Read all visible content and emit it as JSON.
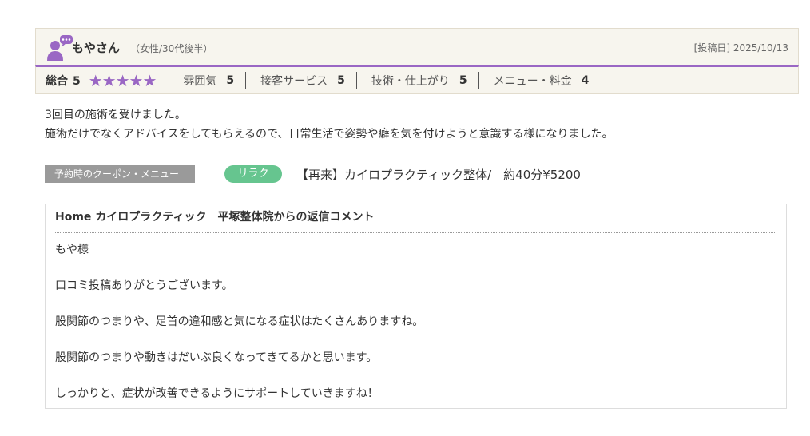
{
  "review": {
    "user_name": "もやさん",
    "user_meta": "（女性/30代後半）",
    "post_date": "[投稿日] 2025/10/13",
    "overall_label": "総合",
    "overall_value": "5",
    "stars_display": "★★★★★",
    "star_count": 5,
    "star_color": "#9a67c4",
    "categories": [
      {
        "label": "雰囲気",
        "value": "5"
      },
      {
        "label": "接客サービス",
        "value": "5"
      },
      {
        "label": "技術・仕上がり",
        "value": "5"
      },
      {
        "label": "メニュー・料金",
        "value": "4"
      }
    ],
    "comment_lines": [
      "3回目の施術を受けました。",
      "施術だけでなくアドバイスをしてもらえるので、日常生活で姿勢や癖を気を付けようと意識する様になりました。"
    ],
    "coupon": {
      "label": "予約時のクーポン・メニュー",
      "badge": "リラク",
      "badge_color": "#66c58f",
      "text": "【再来】カイロプラクティック整体/　約40分¥5200"
    },
    "reply": {
      "title": "Home カイロプラクティック　平塚整体院からの返信コメント",
      "paragraphs": [
        "もや様",
        "口コミ投稿ありがとうございます。",
        "股関節のつまりや、足首の違和感と気になる症状はたくさんありますね。",
        "股関節のつまりや動きはだいぶ良くなってきてるかと思います。",
        "しっかりと、症状が改善できるようにサポートしていきますね！"
      ]
    },
    "icons": {
      "avatar": "user-chat-avatar-icon",
      "star": "star-icon"
    }
  }
}
